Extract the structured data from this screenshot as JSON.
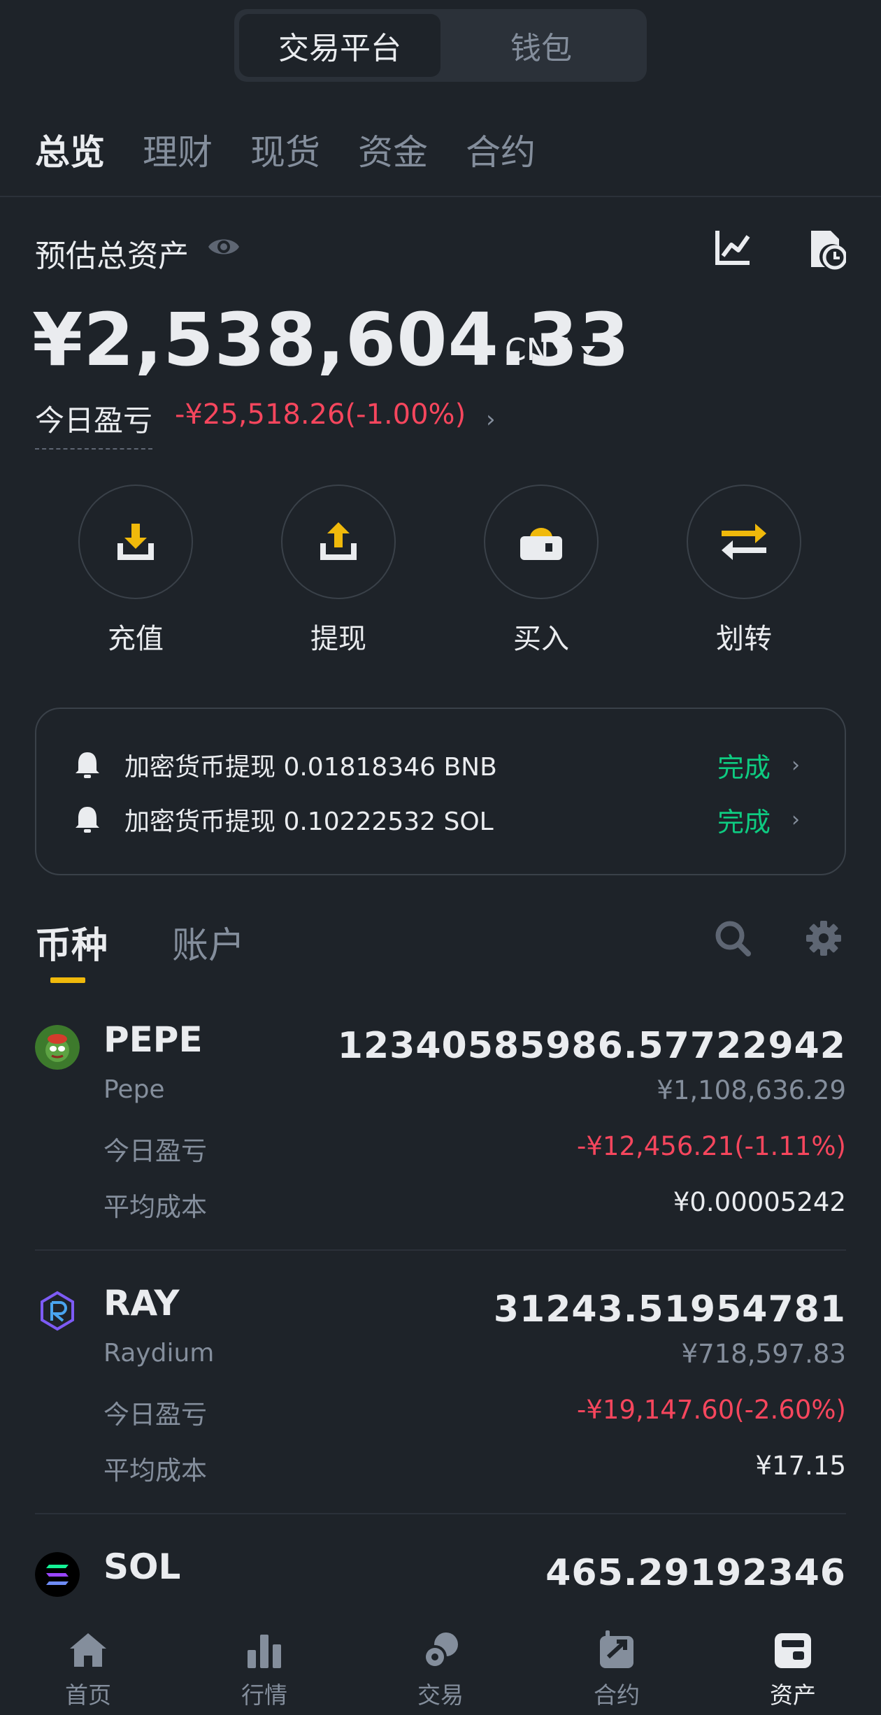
{
  "top_switch": {
    "items": [
      "交易平台",
      "钱包"
    ],
    "active": 0
  },
  "main_tabs": [
    "总览",
    "理财",
    "现货",
    "资金",
    "合约"
  ],
  "overview": {
    "est_label": "预估总资产",
    "total": "¥2,538,604.33",
    "currency": "CNY",
    "pnl_label": "今日盈亏",
    "pnl_value": "-¥25,518.26(-1.00%)"
  },
  "actions": [
    {
      "label": "充值",
      "icon": "deposit-icon"
    },
    {
      "label": "提现",
      "icon": "withdraw-icon"
    },
    {
      "label": "买入",
      "icon": "buy-icon"
    },
    {
      "label": "划转",
      "icon": "transfer-icon"
    }
  ],
  "notifications": [
    {
      "text": "加密货币提现 0.01818346 BNB",
      "status": "完成"
    },
    {
      "text": "加密货币提现 0.10222532 SOL",
      "status": "完成"
    }
  ],
  "asset_tabs": [
    "币种",
    "账户"
  ],
  "assets": [
    {
      "symbol": "PEPE",
      "name": "Pepe",
      "quantity": "12340585986.57722942",
      "value": "¥1,108,636.29",
      "pnl_label": "今日盈亏",
      "pnl": "-¥12,456.21(-1.11%)",
      "cost_label": "平均成本",
      "cost": "¥0.00005242"
    },
    {
      "symbol": "RAY",
      "name": "Raydium",
      "quantity": "31243.51954781",
      "value": "¥718,597.83",
      "pnl_label": "今日盈亏",
      "pnl": "-¥19,147.60(-2.60%)",
      "cost_label": "平均成本",
      "cost": "¥17.15"
    },
    {
      "symbol": "SOL",
      "quantity": "465.29192346"
    }
  ],
  "bottom_nav": [
    {
      "label": "首页",
      "icon": "home-icon"
    },
    {
      "label": "行情",
      "icon": "markets-icon"
    },
    {
      "label": "交易",
      "icon": "trade-icon"
    },
    {
      "label": "合约",
      "icon": "futures-icon"
    },
    {
      "label": "资产",
      "icon": "assets-icon"
    }
  ],
  "colors": {
    "background": "#1e2329",
    "accent": "#f0b90b",
    "negative": "#f6465d",
    "positive": "#0ecb81",
    "muted": "#848e9c"
  }
}
